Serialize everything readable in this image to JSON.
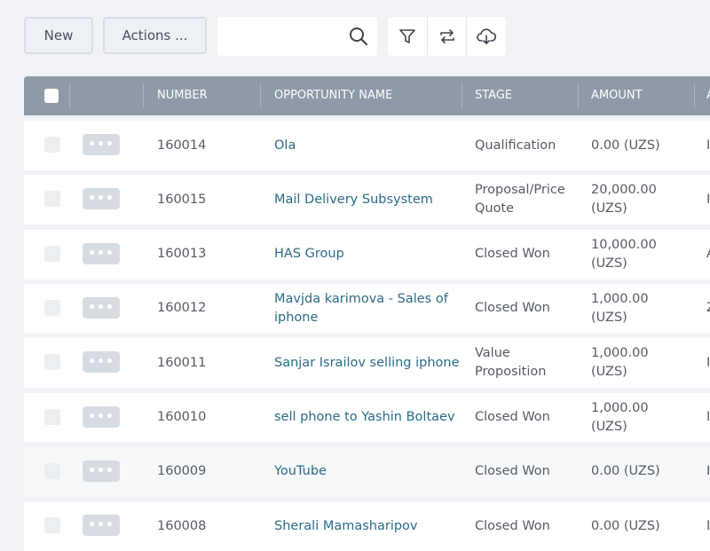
{
  "toolbar": {
    "new_label": "New",
    "actions_label": "Actions ...",
    "search_value": "",
    "icons": [
      "search-icon",
      "filter-icon",
      "sync-icon",
      "cloud-download-icon"
    ]
  },
  "table": {
    "columns": [
      "NUMBER",
      "OPPORTUNITY NAME",
      "STAGE",
      "AMOUNT",
      "A"
    ],
    "dots_label": "•••",
    "rows": [
      {
        "number": "160014",
        "name": "Ola",
        "stage": "Qualification",
        "amount": "0.00 (UZS)",
        "extra": "I"
      },
      {
        "number": "160015",
        "name": "Mail Delivery Subsystem",
        "stage": "Proposal/Price Quote",
        "amount": "20,000.00 (UZS)",
        "extra": "I"
      },
      {
        "number": "160013",
        "name": "HAS Group",
        "stage": "Closed Won",
        "amount": "10,000.00 (UZS)",
        "extra": "A"
      },
      {
        "number": "160012",
        "name": "Mavjda karimova - Sales of iphone",
        "stage": "Closed Won",
        "amount": "1,000.00 (UZS)",
        "extra": "Z"
      },
      {
        "number": "160011",
        "name": "Sanjar Israilov selling iphone",
        "stage": "Value Proposition",
        "amount": "1,000.00 (UZS)",
        "extra": "I"
      },
      {
        "number": "160010",
        "name": "sell phone to Yashin Boltaev",
        "stage": "Closed Won",
        "amount": "1,000.00 (UZS)",
        "extra": "I"
      },
      {
        "number": "160009",
        "name": "YouTube",
        "stage": "Closed Won",
        "amount": "0.00 (UZS)",
        "extra": "I"
      },
      {
        "number": "160008",
        "name": "Sherali Mamasharipov",
        "stage": "Closed Won",
        "amount": "0.00 (UZS)",
        "extra": "I"
      }
    ]
  }
}
